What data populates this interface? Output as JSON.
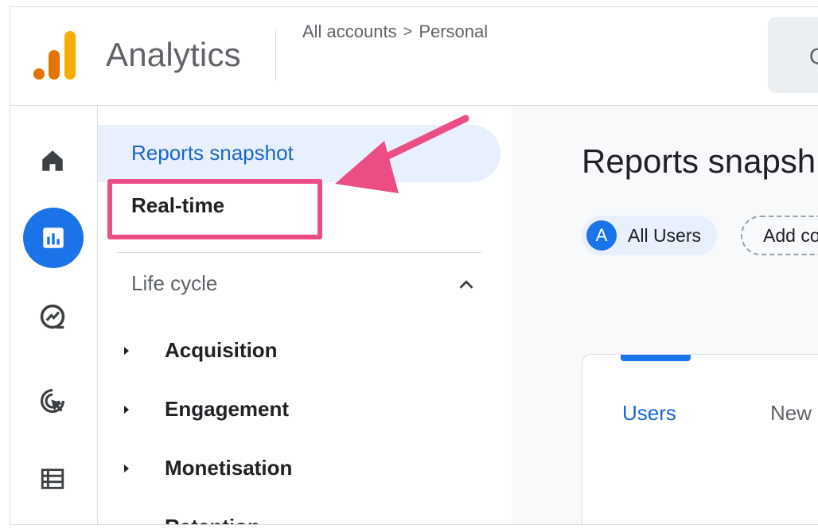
{
  "header": {
    "app_title": "Analytics",
    "breadcrumb": {
      "part1": "All accounts",
      "separator": ">",
      "part2": "Personal"
    },
    "search_glyph": "Q"
  },
  "rail": {
    "icons": [
      "home-icon",
      "reports-icon",
      "explore-icon",
      "advertising-icon",
      "list-icon"
    ],
    "active": "reports-icon"
  },
  "nav": {
    "active_item": "Reports snapshot",
    "realtime": "Real-time",
    "section": "Life cycle",
    "items": [
      {
        "label": "Acquisition",
        "expandable": true
      },
      {
        "label": "Engagement",
        "expandable": true
      },
      {
        "label": "Monetisation",
        "expandable": true
      },
      {
        "label": "Retention",
        "expandable": false
      }
    ]
  },
  "main": {
    "title": "Reports snapsh",
    "chip_avatar": "A",
    "chip_users": "All Users",
    "chip_add": "Add co",
    "tabs": {
      "users": "Users",
      "new": "New"
    }
  },
  "colors": {
    "accent": "#1a73e8",
    "highlight": "#ec4d85",
    "logo_dark": "#e37400",
    "logo_light": "#f9ab00"
  }
}
